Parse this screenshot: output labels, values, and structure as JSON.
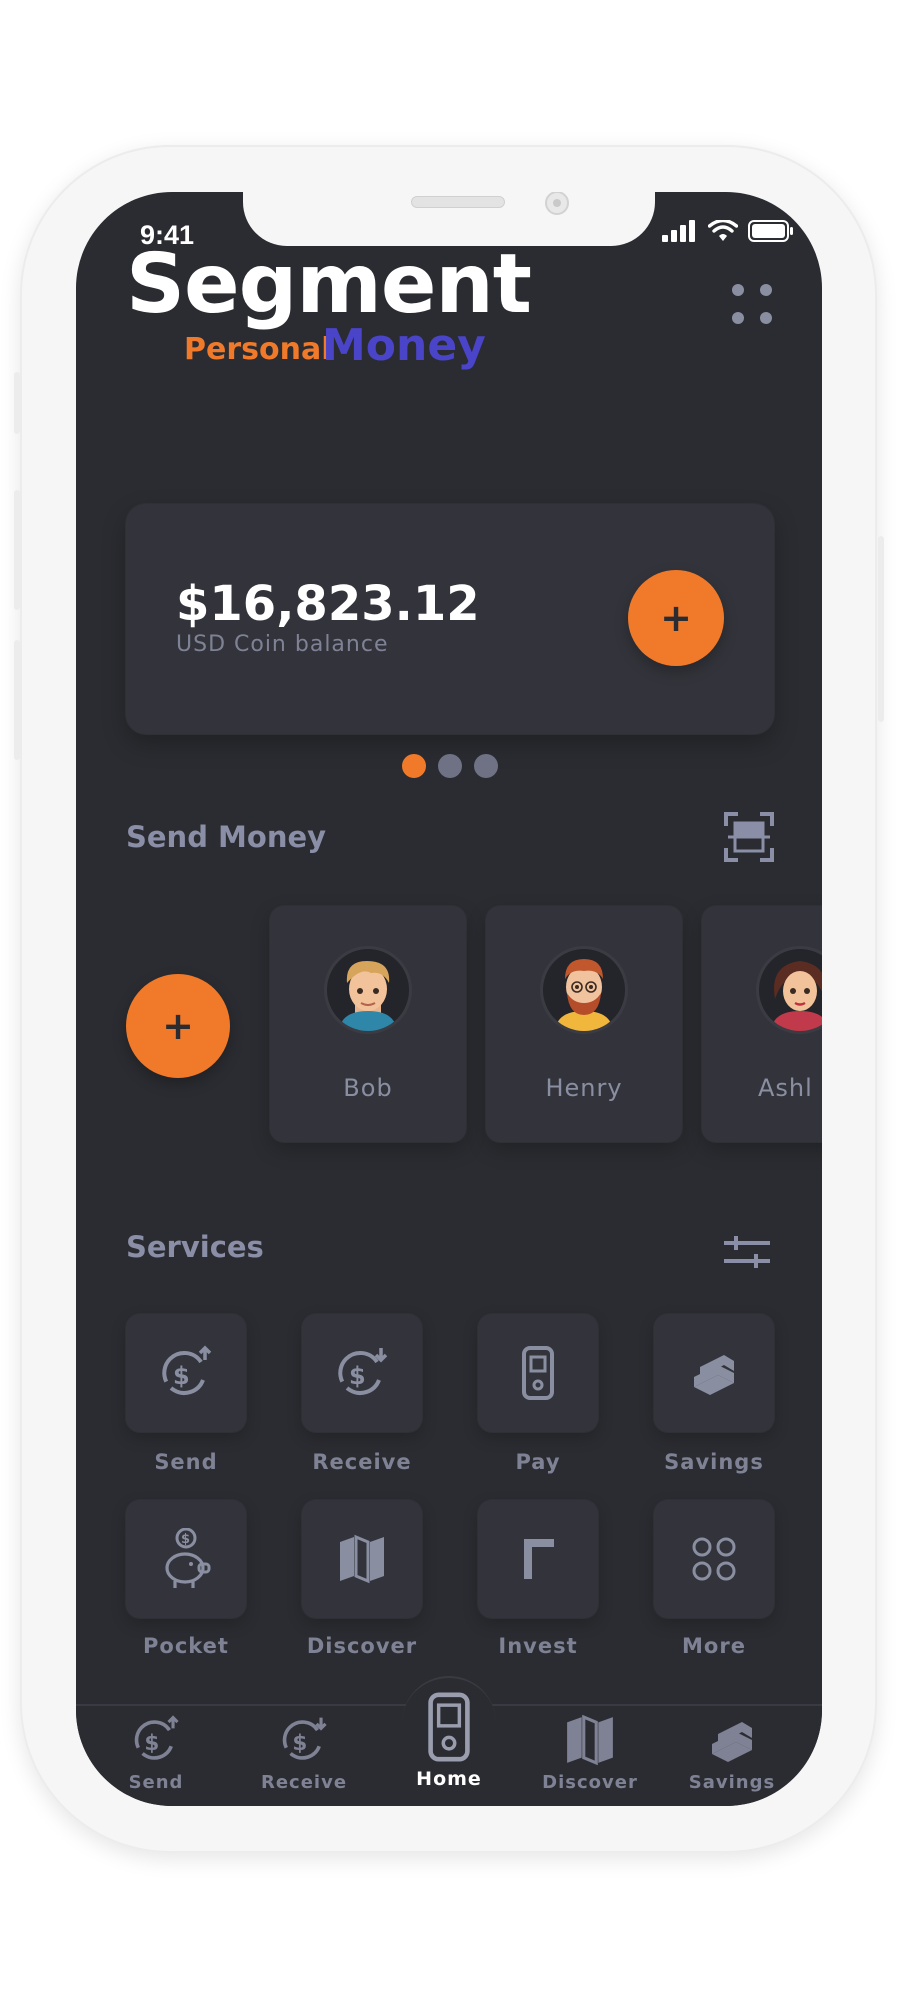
{
  "status_bar": {
    "time": "9:41"
  },
  "brand": {
    "segment": "Segment",
    "personal": "Personal",
    "money": "Money"
  },
  "balance": {
    "amount": "$16,823.12",
    "label": "USD Coin balance",
    "add_symbol": "+"
  },
  "pager": {
    "count": 3,
    "active_index": 0
  },
  "send_money": {
    "title": "Send Money",
    "add_symbol": "+",
    "contacts": [
      {
        "name": "Bob"
      },
      {
        "name": "Henry"
      },
      {
        "name": "Ashl"
      }
    ]
  },
  "services": {
    "title": "Services",
    "items": [
      {
        "label": "Send",
        "icon": "send-money-icon"
      },
      {
        "label": "Receive",
        "icon": "receive-money-icon"
      },
      {
        "label": "Pay",
        "icon": "pay-phone-icon"
      },
      {
        "label": "Savings",
        "icon": "savings-stack-icon"
      },
      {
        "label": "Pocket",
        "icon": "piggy-bank-icon"
      },
      {
        "label": "Discover",
        "icon": "map-icon"
      },
      {
        "label": "Invest",
        "icon": "flag-icon"
      },
      {
        "label": "More",
        "icon": "grid-circles-icon"
      }
    ]
  },
  "bottom_nav": {
    "items": [
      {
        "label": "Send"
      },
      {
        "label": "Receive"
      },
      {
        "label": "Home"
      },
      {
        "label": "Discover"
      },
      {
        "label": "Savings"
      }
    ],
    "active": "Home"
  },
  "colors": {
    "background": "#2b2c31",
    "card": "#33343b",
    "accent_orange": "#f07a2a",
    "accent_blue": "#4a44c8",
    "muted_text": "#8a8ea1"
  }
}
